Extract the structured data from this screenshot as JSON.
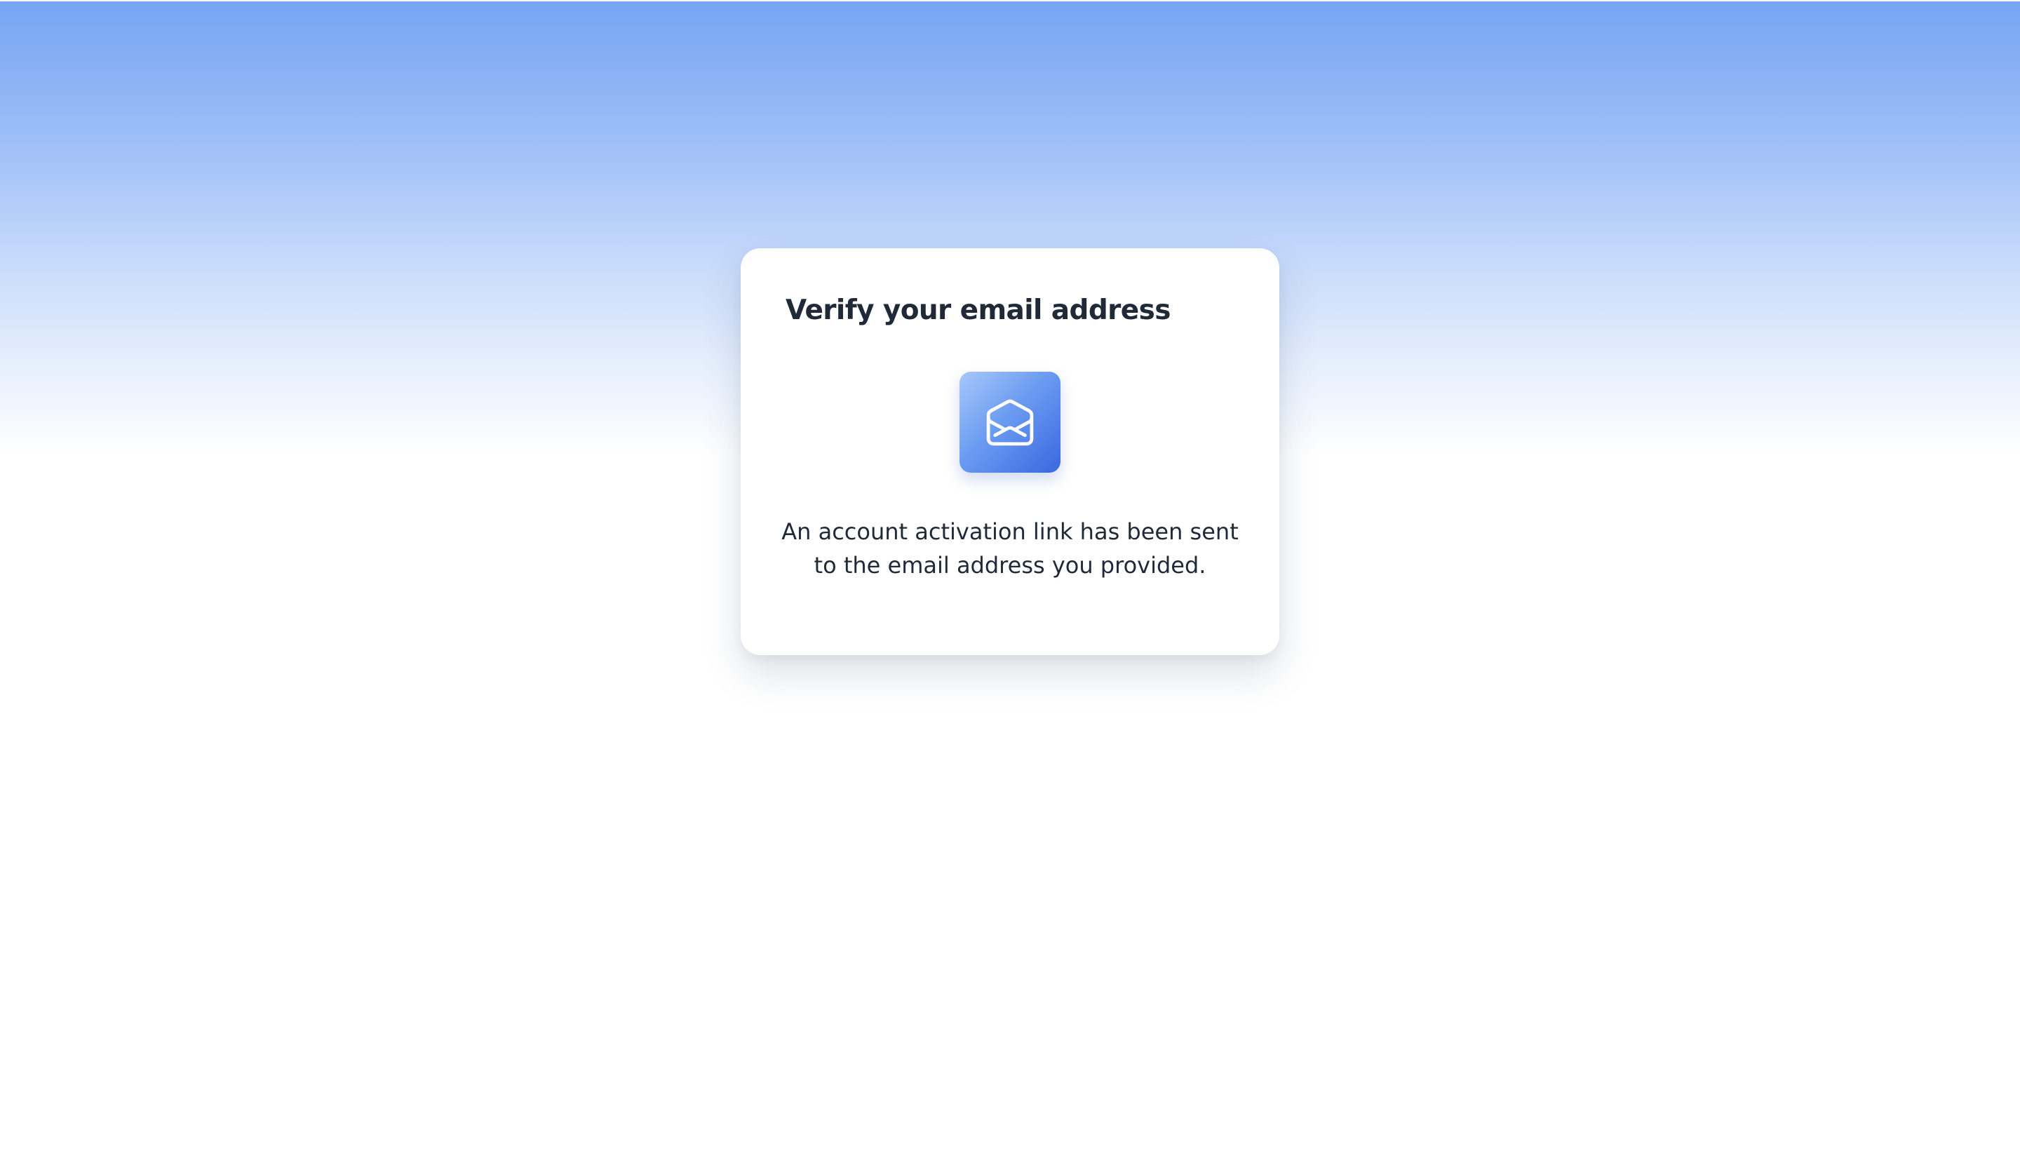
{
  "page": {
    "background_gradient": [
      "#76a5f3",
      "#ffffff"
    ],
    "card_background": "#ffffff"
  },
  "card": {
    "title": "Verify your email address",
    "icon": {
      "name": "envelope-open-icon",
      "tile_gradient": [
        "#a9c8fa",
        "#3a68e0"
      ],
      "glyph_color": "#ffffff"
    },
    "message": "An account activation link has been sent to the email address you provided."
  },
  "colors": {
    "text_primary": "#1f2937",
    "accent": "#3a68e0"
  }
}
